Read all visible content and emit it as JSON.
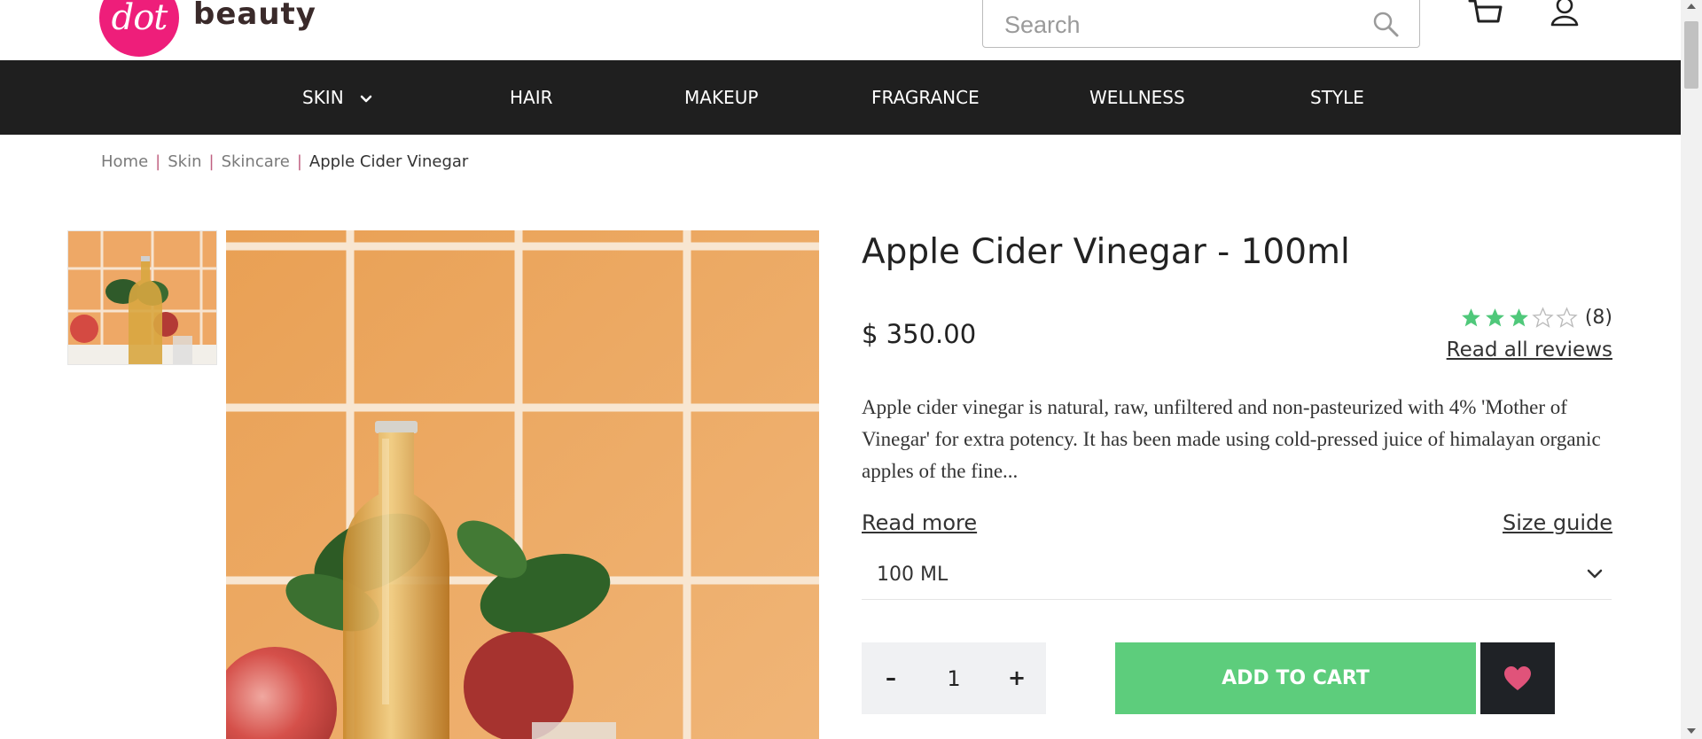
{
  "brand": {
    "logo_mark": "dot",
    "logo_text": "beauty",
    "accent_color": "#ee1e7a"
  },
  "search": {
    "placeholder": "Search",
    "icon": "search-icon"
  },
  "header_icons": [
    "cart-icon",
    "user-icon"
  ],
  "nav": {
    "items": [
      {
        "label": "SKIN",
        "has_dropdown": true
      },
      {
        "label": "HAIR"
      },
      {
        "label": "MAKEUP"
      },
      {
        "label": "FRAGRANCE"
      },
      {
        "label": "WELLNESS"
      },
      {
        "label": "STYLE"
      }
    ],
    "background": "#1f1f1f"
  },
  "breadcrumb": [
    "Home",
    "Skin",
    "Skincare",
    "Apple Cider Vinegar"
  ],
  "product": {
    "title": "Apple Cider Vinegar - 100ml",
    "price": "$ 350.00",
    "rating": {
      "stars": 3,
      "max": 5,
      "count": "(8)",
      "star_color": "#4fc87a"
    },
    "reviews_link": "Read all reviews",
    "description": "Apple cider vinegar is natural, raw, unfiltered and non-pasteurized with 4% 'Mother of Vinegar' for extra potency. It has been made using cold-pressed juice of himalayan organic apples of the fine...",
    "read_more": "Read more",
    "size_guide": "Size guide",
    "size_selected": "100 ML",
    "quantity": {
      "minus": "–",
      "value": "1",
      "plus": "+"
    },
    "add_to_cart": "ADD TO CART",
    "add_to_cart_color": "#5dcd7c",
    "wishlist_icon": "heart-icon",
    "wishlist_heart_color": "#e0537a"
  }
}
